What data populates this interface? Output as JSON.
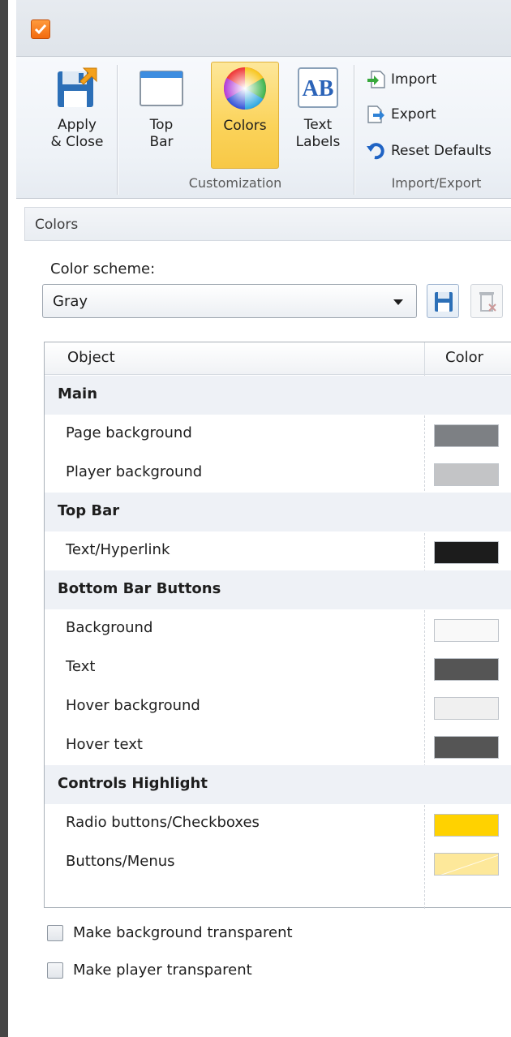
{
  "ribbon": {
    "apply_close": "Apply\n& Close",
    "top_bar": "Top\nBar",
    "colors": "Colors",
    "text_labels": "Text\nLabels",
    "import": "Import",
    "export": "Export",
    "reset_defaults": "Reset Defaults",
    "group_customization": "Customization",
    "group_import_export": "Import/Export"
  },
  "panel": {
    "header": "Colors",
    "scheme_label": "Color scheme:",
    "scheme_value": "Gray"
  },
  "table": {
    "col_object": "Object",
    "col_color": "Color",
    "rows": [
      {
        "label": "Main",
        "group": true
      },
      {
        "label": "Page background",
        "color": "#7d8084"
      },
      {
        "label": "Player background",
        "color": "#c3c4c6"
      },
      {
        "label": "Top Bar",
        "group": true
      },
      {
        "label": "Text/Hyperlink",
        "color": "#1c1c1c"
      },
      {
        "label": "Bottom Bar Buttons",
        "group": true
      },
      {
        "label": "Background",
        "color": "#f9f9f9"
      },
      {
        "label": "Text",
        "color": "#555555"
      },
      {
        "label": "Hover background",
        "color": "#f0f0f0"
      },
      {
        "label": "Hover text",
        "color": "#555555"
      },
      {
        "label": "Controls Highlight",
        "group": true
      },
      {
        "label": "Radio buttons/Checkboxes",
        "color": "#ffd200"
      },
      {
        "label": "Buttons/Menus",
        "color": "#fde89a"
      }
    ]
  },
  "options": {
    "bg_transparent": "Make background transparent",
    "player_transparent": "Make player transparent"
  },
  "icons": {
    "app": "checkbox-app-icon",
    "apply": "save-floppy-icon",
    "top_bar": "window-icon",
    "colors": "color-wheel-icon",
    "text_labels": "text-ab-icon",
    "import": "import-arrow-icon",
    "export": "export-arrow-icon",
    "reset": "reset-undo-icon",
    "save_scheme": "save-icon",
    "delete_scheme": "delete-icon"
  }
}
